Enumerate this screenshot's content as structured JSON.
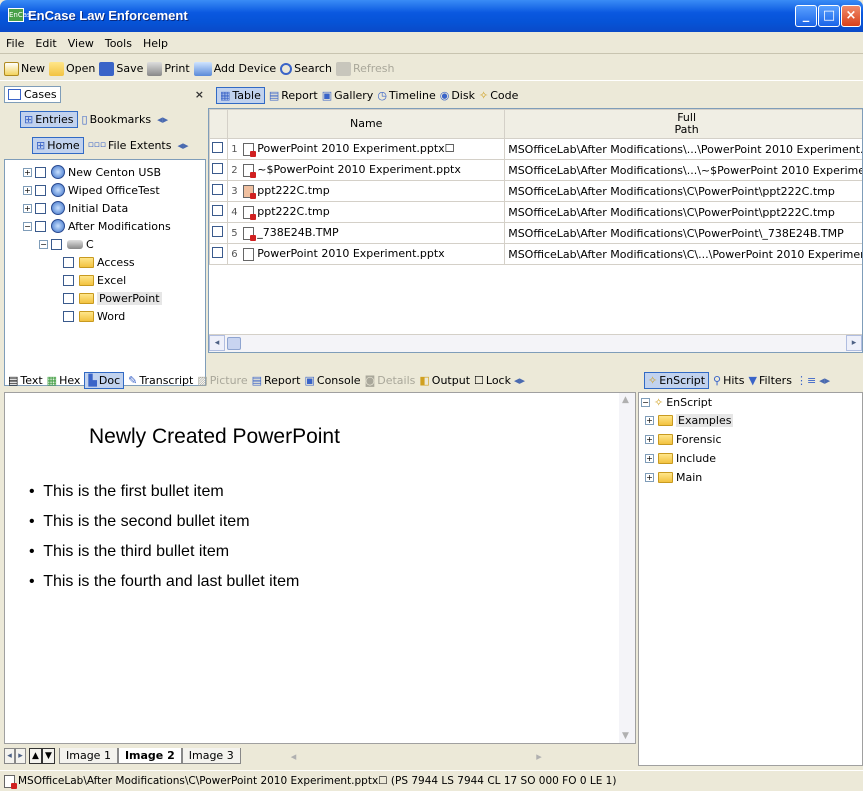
{
  "window": {
    "title": "EnCase Law Enforcement",
    "icon_label": "EnCase"
  },
  "menu": [
    "File",
    "Edit",
    "View",
    "Tools",
    "Help"
  ],
  "toolbar": {
    "new": "New",
    "open": "Open",
    "save": "Save",
    "print": "Print",
    "add_device": "Add Device",
    "search": "Search",
    "refresh": "Refresh"
  },
  "left_pane": {
    "cases_tab": "Cases",
    "entries": "Entries",
    "bookmarks": "Bookmarks",
    "home": "Home",
    "file_extents": "File Extents",
    "tree": [
      {
        "label": "New Centon USB",
        "level": 0
      },
      {
        "label": "Wiped OfficeTest",
        "level": 0
      },
      {
        "label": "Initial Data",
        "level": 0
      },
      {
        "label": "After Modifications",
        "level": 0
      },
      {
        "label": "C",
        "level": 1
      },
      {
        "label": "Access",
        "level": 2
      },
      {
        "label": "Excel",
        "level": 2
      },
      {
        "label": "PowerPoint",
        "level": 2,
        "selected": true
      },
      {
        "label": "Word",
        "level": 2
      }
    ]
  },
  "right_toolbar": {
    "table": "Table",
    "report": "Report",
    "gallery": "Gallery",
    "timeline": "Timeline",
    "disk": "Disk",
    "code": "Code"
  },
  "table": {
    "headers": {
      "name": "Name",
      "full_path_line1": "Full",
      "full_path_line2": "Path"
    },
    "rows": [
      {
        "num": "1",
        "name": "PowerPoint 2010 Experiment.pptx☐",
        "path": "MSOfficeLab\\After Modifications\\...\\PowerPoint 2010 Experiment.",
        "icon": "deleted-file-icon"
      },
      {
        "num": "2",
        "name": "~$PowerPoint 2010 Experiment.pptx",
        "path": "MSOfficeLab\\After Modifications\\...\\~$PowerPoint 2010 Experime",
        "icon": "deleted-file-icon"
      },
      {
        "num": "3",
        "name": "ppt222C.tmp",
        "path": "MSOfficeLab\\After Modifications\\C\\PowerPoint\\ppt222C.tmp",
        "icon": "overwritten-file-icon"
      },
      {
        "num": "4",
        "name": "ppt222C.tmp",
        "path": "MSOfficeLab\\After Modifications\\C\\PowerPoint\\ppt222C.tmp",
        "icon": "deleted-file-icon"
      },
      {
        "num": "5",
        "name": "_738E24B.TMP",
        "path": "MSOfficeLab\\After Modifications\\C\\PowerPoint\\_738E24B.TMP",
        "icon": "deleted-file-icon"
      },
      {
        "num": "6",
        "name": "PowerPoint 2010 Experiment.pptx",
        "path": "MSOfficeLab\\After Modifications\\C\\...\\PowerPoint 2010 Experimer",
        "icon": "file-icon"
      }
    ]
  },
  "view_tabs": {
    "text": "Text",
    "hex": "Hex",
    "doc": "Doc",
    "transcript": "Transcript",
    "picture": "Picture",
    "report": "Report",
    "console": "Console",
    "details": "Details",
    "output": "Output",
    "lock": "Lock"
  },
  "doc_view": {
    "heading": "Newly Created PowerPoint",
    "bullets": [
      "This is the first bullet item",
      "This is the second bullet item",
      "This is the third bullet item",
      "This is the fourth and last bullet item"
    ]
  },
  "image_tabs": [
    "Image 1",
    "Image 2",
    "Image 3"
  ],
  "script_pane": {
    "enscript_tab": "EnScript",
    "hits": "Hits",
    "filters": "Filters",
    "tree_root": "EnScript",
    "tree": [
      "Examples",
      "Forensic",
      "Include",
      "Main"
    ]
  },
  "status_bar": "MSOfficeLab\\After Modifications\\C\\PowerPoint 2010 Experiment.pptx☐ (PS 7944  LS 7944  CL 17  SO 000  FO 0  LE 1)"
}
